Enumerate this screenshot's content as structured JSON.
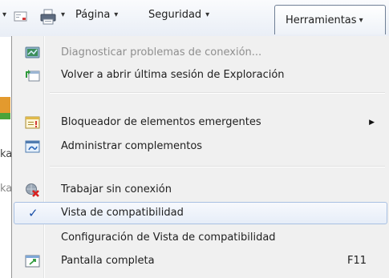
{
  "command_bar": {
    "page_label": "Página",
    "security_label": "Seguridad",
    "tools_label": "Herramientas",
    "dropdown_glyph": "▾",
    "icons": [
      "feeds-icon",
      "mail-icon",
      "print-icon"
    ]
  },
  "background": {
    "fragments": [
      "ka",
      "ka"
    ]
  },
  "menu": {
    "items": [
      {
        "id": "diagnose",
        "label": "Diagnosticar problemas de conexión...",
        "icon": "network-diagnose-icon",
        "enabled": false
      },
      {
        "id": "reopen",
        "label": "Volver a abrir última sesión de Exploración",
        "icon": "reopen-session-icon",
        "enabled": true
      },
      {
        "id": "popup",
        "label": "Bloqueador de elementos emergentes",
        "icon": "popup-blocker-icon",
        "enabled": true,
        "submenu": true
      },
      {
        "id": "addons",
        "label": "Administrar complementos",
        "icon": "manage-addons-icon",
        "enabled": true
      },
      {
        "id": "offline",
        "label": "Trabajar sin conexión",
        "icon": "work-offline-icon",
        "enabled": true
      },
      {
        "id": "compat",
        "label": "Vista de compatibilidad",
        "icon": "checkmark-icon",
        "enabled": true,
        "checked": true
      },
      {
        "id": "compat_settings",
        "label": "Configuración de Vista de compatibilidad",
        "enabled": true
      },
      {
        "id": "fullscreen",
        "label": "Pantalla completa",
        "icon": "fullscreen-icon",
        "enabled": true,
        "shortcut": "F11"
      }
    ],
    "submenu_arrow": "▶",
    "check_glyph": "✓"
  }
}
